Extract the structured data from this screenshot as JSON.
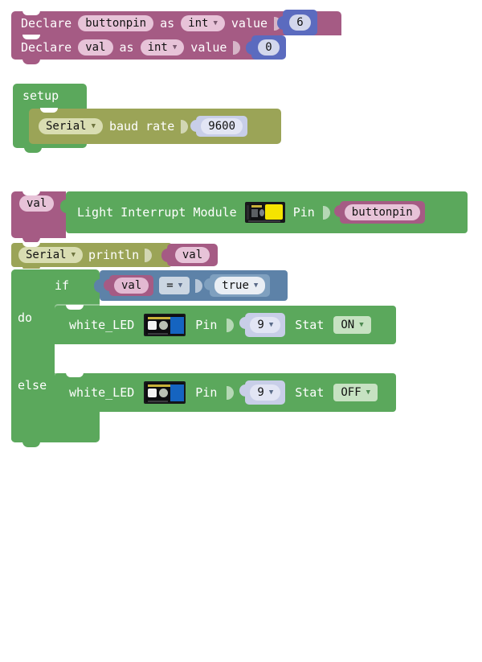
{
  "program": {
    "title": "Blockly visual program",
    "declarations": [
      {
        "keyword": "Declare",
        "variable": "buttonpin",
        "as_label": "as",
        "type": "int",
        "value_label": "value",
        "value": "6"
      },
      {
        "keyword": "Declare",
        "variable": "val",
        "as_label": "as",
        "type": "int",
        "value_label": "value",
        "value": "0"
      }
    ],
    "setup": {
      "label": "setup",
      "serial": {
        "port": "Serial",
        "text": "baud rate",
        "baud": "9600"
      }
    },
    "loop": {
      "assign": {
        "variable": "val",
        "module_label": "Light Interrupt Module",
        "module_icon": "light-interrupt-sensor-icon",
        "pin_label": "Pin",
        "pin_value": "buttonpin"
      },
      "print": {
        "port": "Serial",
        "method": "println",
        "argument": "val"
      },
      "if_block": {
        "settings_icon": "gear-icon",
        "if_label": "if",
        "condition": {
          "left": "val",
          "operator": "=",
          "right": "true"
        },
        "do_label": "do",
        "else_label": "else",
        "do_statement": {
          "name": "white_LED",
          "module_icon": "white-led-module-icon",
          "pin_label": "Pin",
          "pin_value": "9",
          "stat_label": "Stat",
          "stat_value": "ON"
        },
        "else_statement": {
          "name": "white_LED",
          "module_icon": "white-led-module-icon",
          "pin_label": "Pin",
          "pin_value": "9",
          "stat_label": "Stat",
          "stat_value": "OFF"
        }
      }
    }
  },
  "colors": {
    "variable": "#A55B84",
    "number": "#5B6BBF",
    "control": "#5BA85C",
    "serial": "#9BA457",
    "logic": "#5D82A8",
    "gear_icon": "#2E5FD0"
  }
}
